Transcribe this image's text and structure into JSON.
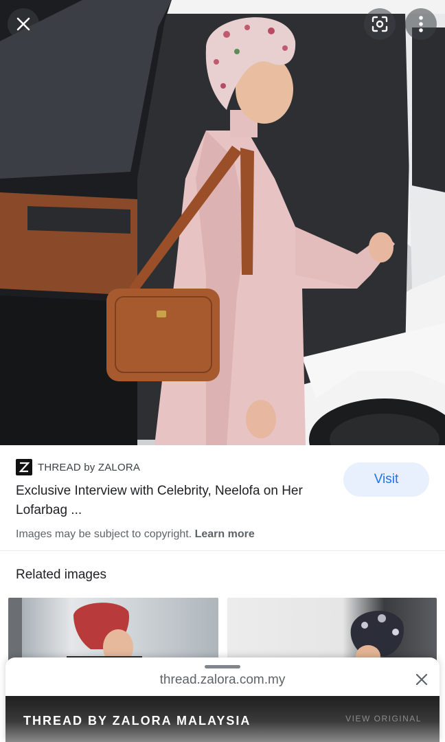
{
  "hero": {
    "image_alt": "Woman in pink coat and floral head wrap with a tan shoulder bag stepping out of a white car"
  },
  "hero_controls": {
    "close_icon": "close-icon",
    "lens_icon": "lens-icon",
    "more_icon": "more-vert-icon"
  },
  "source": {
    "logo_letter": "Z",
    "name": "THREAD by ZALORA"
  },
  "result": {
    "title": "Exclusive Interview with Celebrity, Neelofa on Her Lofarbag ...",
    "visit_label": "Visit",
    "copyright_text": "Images may be subject to copyright.",
    "learn_more_label": "Learn more"
  },
  "related": {
    "heading": "Related images"
  },
  "sheet": {
    "url": "thread.zalora.com.my",
    "preview_title": "THREAD BY ZALORA MALAYSIA",
    "preview_action": "VIEW ORIGINAL"
  },
  "colors": {
    "accent": "#1a73e8",
    "visit_bg": "#e8f0fe",
    "coat_pink": "#e8c3c3",
    "bag_tan": "#a65a2e"
  }
}
